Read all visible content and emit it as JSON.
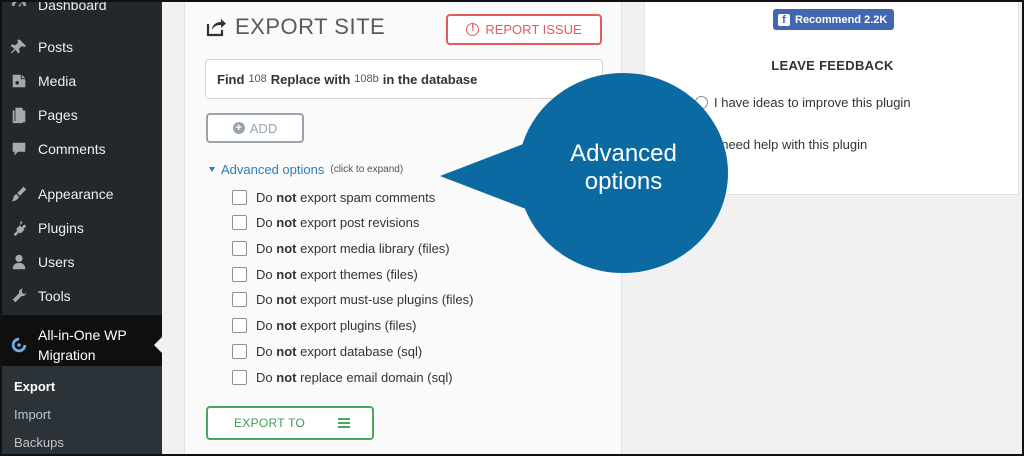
{
  "sidebar": {
    "items": [
      {
        "label": "Dashboard",
        "icon": "dashboard-icon"
      },
      {
        "label": "Posts",
        "icon": "pin-icon"
      },
      {
        "label": "Media",
        "icon": "media-icon"
      },
      {
        "label": "Pages",
        "icon": "pages-icon"
      },
      {
        "label": "Comments",
        "icon": "comment-icon"
      },
      {
        "label": "Appearance",
        "icon": "brush-icon"
      },
      {
        "label": "Plugins",
        "icon": "plug-icon"
      },
      {
        "label": "Users",
        "icon": "user-icon"
      },
      {
        "label": "Tools",
        "icon": "wrench-icon"
      }
    ],
    "active_item": {
      "label": "All-in-One WP Migration",
      "icon": "migration-icon"
    },
    "submenu": [
      "Export",
      "Import",
      "Backups"
    ]
  },
  "export_panel": {
    "title": "EXPORT SITE",
    "report_issue_label": "REPORT ISSUE",
    "find_replace": {
      "find_label": "Find",
      "find_value": "108",
      "replace_label": "Replace with",
      "replace_value": "108b",
      "suffix": "in the database"
    },
    "add_label": "ADD",
    "advanced": {
      "label": "Advanced options",
      "hint": "(click to expand)"
    },
    "options": [
      {
        "prefix": "Do",
        "bold": "not",
        "rest": "export spam comments"
      },
      {
        "prefix": "Do",
        "bold": "not",
        "rest": "export post revisions"
      },
      {
        "prefix": "Do",
        "bold": "not",
        "rest": "export media library (files)"
      },
      {
        "prefix": "Do",
        "bold": "not",
        "rest": "export themes (files)"
      },
      {
        "prefix": "Do",
        "bold": "not",
        "rest": "export must-use plugins (files)"
      },
      {
        "prefix": "Do",
        "bold": "not",
        "rest": "export plugins (files)"
      },
      {
        "prefix": "Do",
        "bold": "not",
        "rest": "export database (sql)"
      },
      {
        "prefix": "Do",
        "bold": "not",
        "rest": "replace email domain (sql)"
      }
    ],
    "export_to_label": "EXPORT TO"
  },
  "feedback": {
    "recommend_label": "Recommend 2.2K",
    "title": "LEAVE FEEDBACK",
    "options": [
      "I have ideas to improve this plugin",
      "I need help with this plugin"
    ]
  },
  "callout": {
    "line1": "Advanced",
    "line2": "options",
    "color": "#0b6aa2"
  }
}
